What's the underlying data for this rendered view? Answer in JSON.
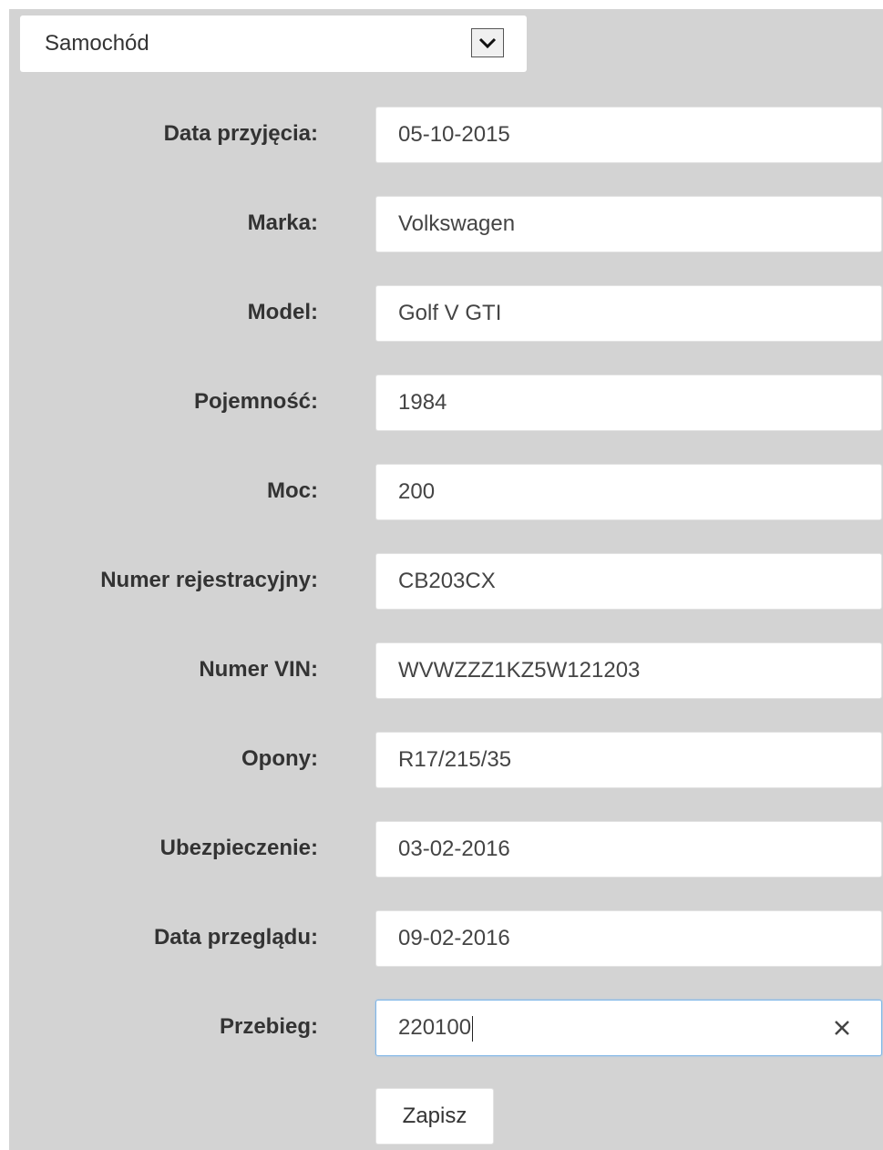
{
  "vehicle_type": {
    "selected": "Samochód"
  },
  "fields": [
    {
      "label": "Data przyjęcia:",
      "value": "05-10-2015"
    },
    {
      "label": "Marka:",
      "value": "Volkswagen"
    },
    {
      "label": "Model:",
      "value": "Golf V GTI"
    },
    {
      "label": "Pojemność:",
      "value": "1984"
    },
    {
      "label": "Moc:",
      "value": "200"
    },
    {
      "label": "Numer rejestracyjny:",
      "value": "CB203CX"
    },
    {
      "label": "Numer VIN:",
      "value": "WVWZZZ1KZ5W121203"
    },
    {
      "label": "Opony:",
      "value": "R17/215/35"
    },
    {
      "label": "Ubezpieczenie:",
      "value": "03-02-2016"
    },
    {
      "label": "Data przeglądu:",
      "value": "09-02-2016"
    },
    {
      "label": "Przebieg:",
      "value": "220100"
    }
  ],
  "icons": {
    "dropdown": "chevron-down-icon",
    "clear": "close-icon"
  },
  "actions": {
    "save_label": "Zapisz"
  },
  "colors": {
    "panel_bg": "#d3d3d3",
    "focus_border": "#7fb5e6"
  }
}
